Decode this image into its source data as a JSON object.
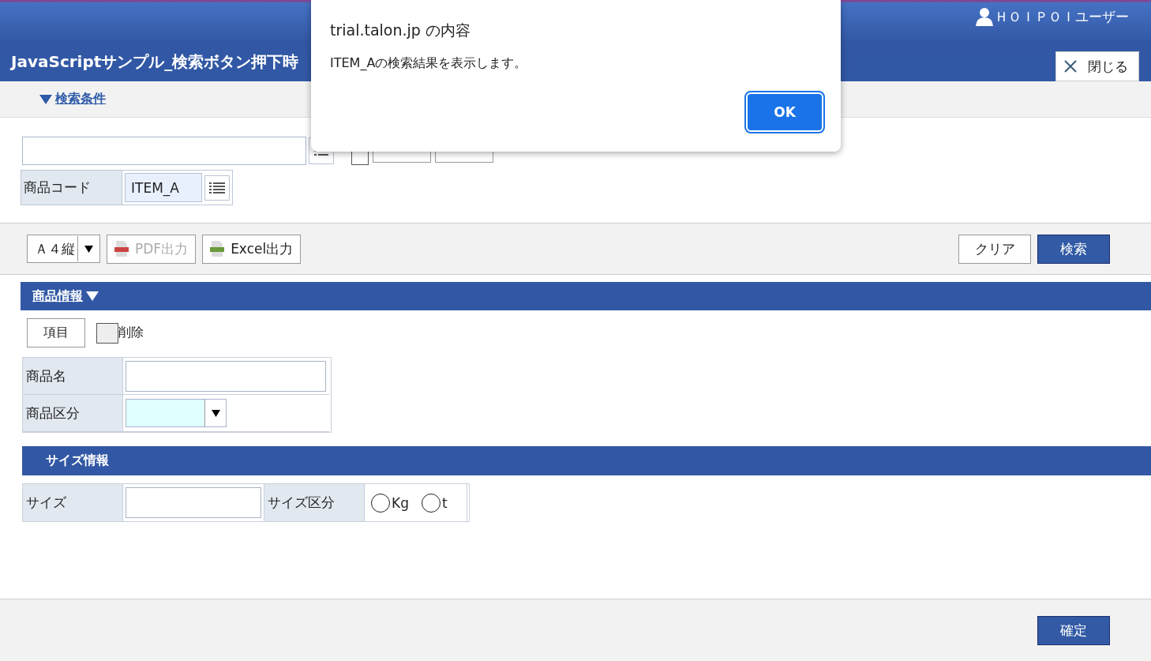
{
  "header": {
    "user": "ＨＯＩＰＯＩユーザー",
    "title": "JavaScriptサンプル_検索ボタン押下時",
    "close_button": "閉じる"
  },
  "search_section": {
    "label": "検索条件",
    "expanded": true
  },
  "condition_row": {
    "checked": false
  },
  "product_code": {
    "label": "商品コード",
    "value": "ITEM_A"
  },
  "toolbar": {
    "paper": "Ａ４縦",
    "pdf": "PDF出力",
    "pdf_disabled": true,
    "excel": "Excel出力",
    "clear": "クリア",
    "search": "検索"
  },
  "product_section": {
    "title": "商品情報",
    "expanded": true,
    "item_button": "項目",
    "delete_label": "削除",
    "delete_checked": false,
    "fields": [
      {
        "label": "商品名",
        "kind": "text"
      },
      {
        "label": "商品区分",
        "kind": "select"
      }
    ]
  },
  "size_section": {
    "title": "サイズ情報",
    "size_label": "サイズ",
    "unit_label": "サイズ区分",
    "units": [
      {
        "label": "Kg",
        "selected": false
      },
      {
        "label": "t",
        "selected": false
      }
    ]
  },
  "footer": {
    "confirm": "確定"
  },
  "dialog": {
    "title": "trial.talon.jp の内容",
    "message": "ITEM_Aの検索結果を表示します。",
    "ok": "OK"
  }
}
